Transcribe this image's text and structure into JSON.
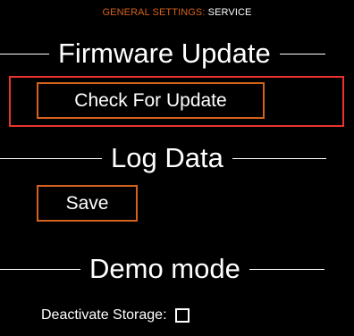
{
  "breadcrumb": {
    "parent": "GENERAL SETTINGS:",
    "current": " SERVICE"
  },
  "sections": {
    "firmware": {
      "title": "Firmware Update",
      "button_label": "Check For Update"
    },
    "log": {
      "title": "Log Data",
      "button_label": "Save"
    },
    "demo": {
      "title": "Demo mode",
      "storage_label": "Deactivate Storage:",
      "storage_checked": false
    }
  },
  "colors": {
    "background": "#000000",
    "accent": "#d4621c",
    "text": "#ffffff",
    "highlight": "#e8332e"
  }
}
